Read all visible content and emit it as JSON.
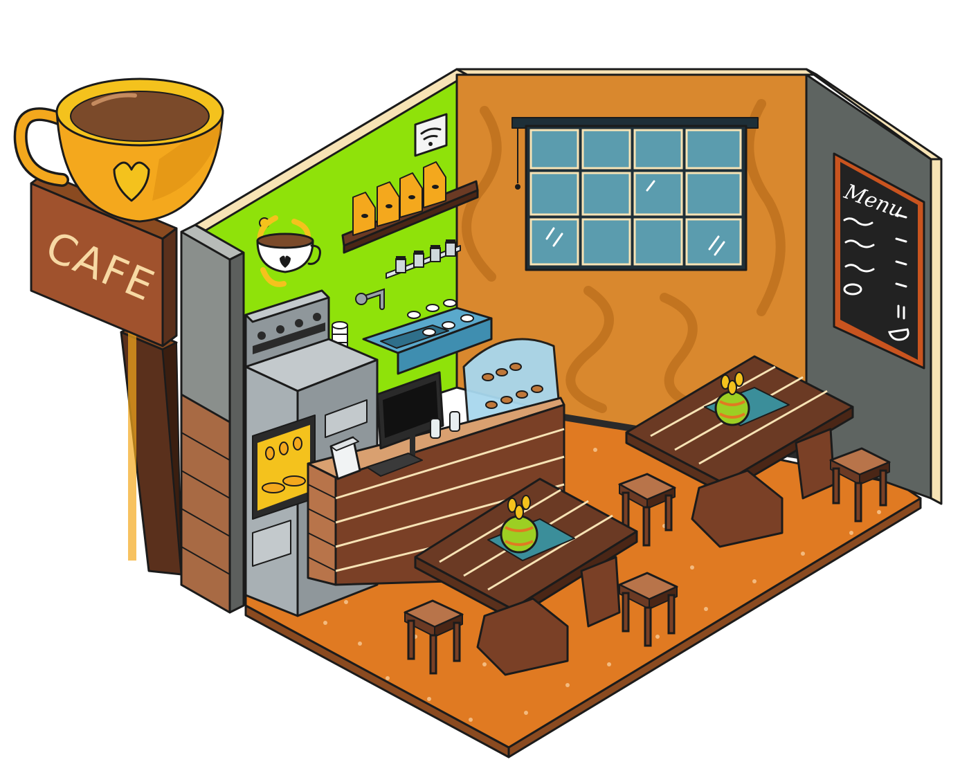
{
  "sign": {
    "text": "CAFE"
  },
  "menu_board": {
    "title": "Menu"
  },
  "colors": {
    "outline": "#1b1b1b",
    "sign_board": "#a0522d",
    "sign_text": "#f7d9a4",
    "cup": "#f4a81d",
    "coffee": "#7b4a2a",
    "green_wall": "#8fe20a",
    "orange_wall": "#d9882e",
    "grey_wall": "#5e6461",
    "window_glass": "#5b9cae",
    "window_frame": "#1e2f38",
    "floor": "#e07a22",
    "wood_dark": "#6b3a24",
    "wood_light": "#b8744a",
    "chalkboard": "#222222",
    "display_glass": "#a8d8ee"
  },
  "icons": [
    "wifi-icon",
    "coffee-cup-icon",
    "heart-icon"
  ]
}
